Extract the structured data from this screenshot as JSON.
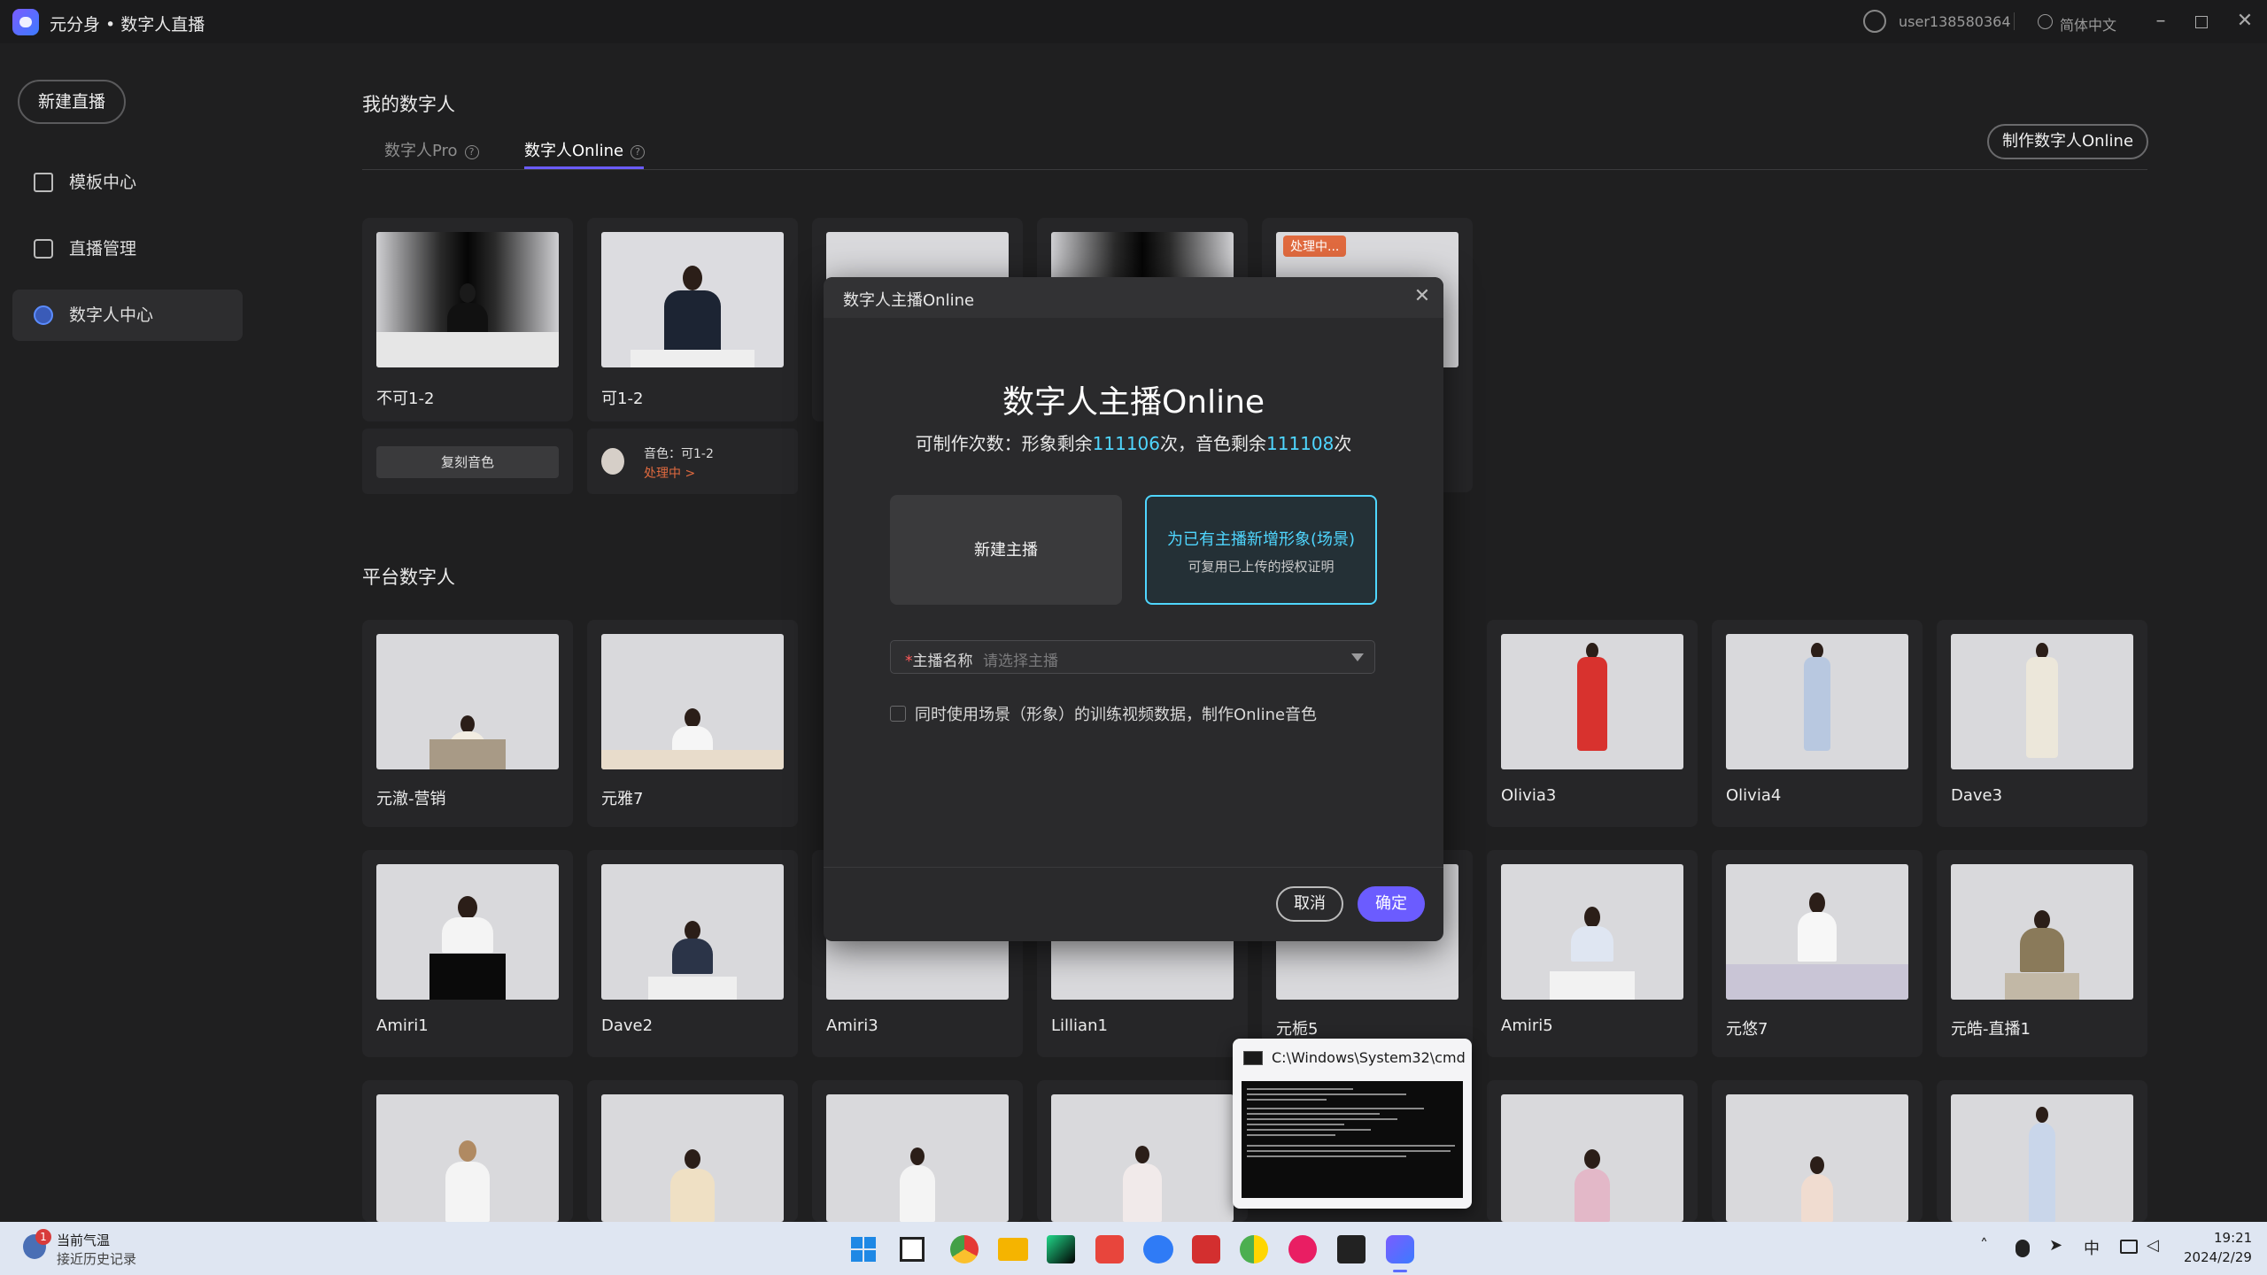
{
  "window": {
    "title": "元分身 • 数字人直播",
    "username": "user138580364",
    "language": "简体中文"
  },
  "sidebar": {
    "new_live_label": "新建直播",
    "items": [
      {
        "label": "模板中心",
        "icon": "template-icon"
      },
      {
        "label": "直播管理",
        "icon": "video-camera-icon"
      },
      {
        "label": "数字人中心",
        "icon": "globe-icon",
        "active": true
      }
    ]
  },
  "my_section": {
    "title": "我的数字人",
    "tabs": [
      {
        "label": "数字人Pro",
        "active": false
      },
      {
        "label": "数字人Online",
        "active": true
      }
    ],
    "make_button": "制作数字人Online",
    "cards": [
      {
        "name": "不可1-2",
        "sub_button": "复刻音色"
      },
      {
        "name": "可1-2",
        "voice_label": "音色：可1-2",
        "voice_status": "处理中 >"
      },
      {
        "name": ""
      },
      {
        "name": ""
      },
      {
        "name": "",
        "badge": "处理中..."
      }
    ]
  },
  "platform_section": {
    "title": "平台数字人",
    "row1": [
      "元澈-营销",
      "元雅7",
      "",
      "",
      "",
      "Olivia3",
      "Olivia4",
      "Dave3"
    ],
    "row2": [
      "Amiri1",
      "Dave2",
      "Amiri3",
      "Lillian1",
      "元栀5",
      "Amiri5",
      "元悠7",
      "元皓-直播1"
    ]
  },
  "dialog": {
    "title": "数字人主播Online",
    "heading": "数字人主播Online",
    "quota_prefix": "可制作次数：形象剩余",
    "image_remaining": "111106",
    "quota_mid": "次，音色剩余",
    "voice_remaining": "111108",
    "quota_suffix": "次",
    "option_new": "新建主播",
    "option_add_title": "为已有主播新增形象(场景)",
    "option_add_sub": "可复用已上传的授权证明",
    "anchor_label": "主播名称",
    "anchor_required": "*",
    "anchor_placeholder": "请选择主播",
    "checkbox_label": "同时使用场景（形象）的训练视频数据，制作Online音色",
    "cancel": "取消",
    "confirm": "确定"
  },
  "cmd_preview": {
    "title": "C:\\Windows\\System32\\cmd...."
  },
  "taskbar": {
    "weather_title": "当前气温",
    "weather_sub": "接近历史记录",
    "notification_count": "1",
    "ime": "中",
    "time": "19:21",
    "date": "2024/2/29"
  },
  "colors": {
    "accent": "#6b5cff",
    "highlight": "#4fd6ff",
    "processing": "#e06a3f"
  }
}
